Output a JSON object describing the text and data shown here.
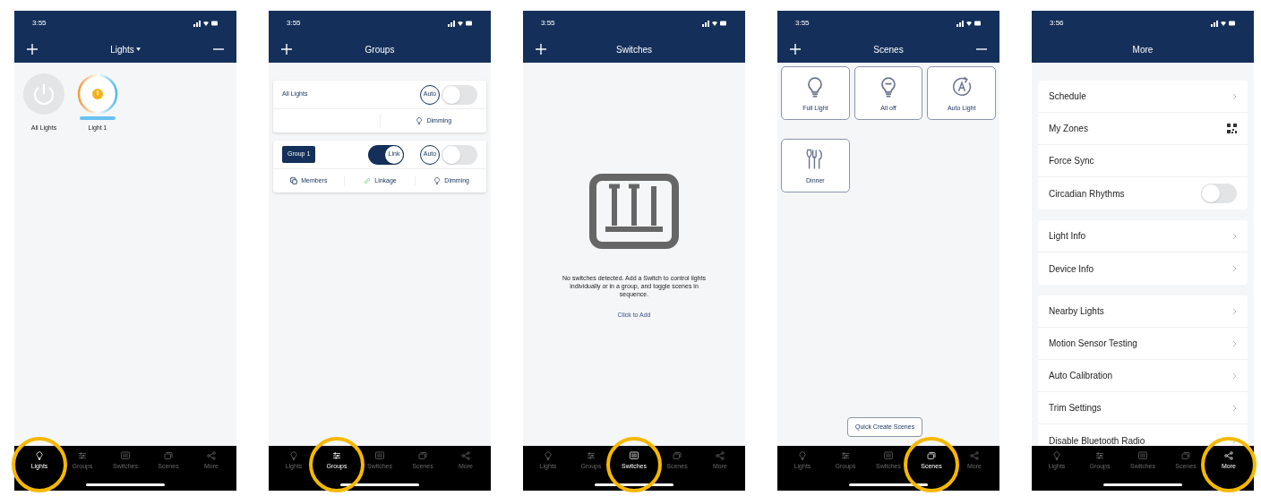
{
  "phones": [
    {
      "kind": "lights",
      "status_time": "3:55",
      "title": "Lights",
      "lights": [
        {
          "label": "All Lights",
          "on": false
        },
        {
          "label": "Light 1",
          "on": true
        }
      ],
      "tabs": [
        {
          "label": "Lights",
          "selected": true
        },
        {
          "label": "Groups",
          "selected": false
        },
        {
          "label": "Switches",
          "selected": false
        },
        {
          "label": "Scenes",
          "selected": false
        },
        {
          "label": "More",
          "selected": false
        }
      ]
    },
    {
      "kind": "groups",
      "status_time": "3:55",
      "title": "Groups",
      "groups": [
        {
          "kind": "all",
          "name": "All Lights",
          "auto_label": "Auto",
          "auto_on": false,
          "actions": [
            {
              "kind": "dimming",
              "label": "Dimming"
            }
          ]
        },
        {
          "kind": "group",
          "name": "Group 1",
          "link_label": "Link",
          "link_on": true,
          "auto_label": "Auto",
          "auto_on": false,
          "actions": [
            {
              "kind": "members",
              "label": "Members"
            },
            {
              "kind": "linkage",
              "label": "Linkage"
            },
            {
              "kind": "dimming",
              "label": "Dimming"
            }
          ]
        }
      ],
      "tabs": [
        {
          "label": "Lights",
          "selected": false
        },
        {
          "label": "Groups",
          "selected": true
        },
        {
          "label": "Switches",
          "selected": false
        },
        {
          "label": "Scenes",
          "selected": false
        },
        {
          "label": "More",
          "selected": false
        }
      ]
    },
    {
      "kind": "switches",
      "status_time": "3:55",
      "title": "Switches",
      "message": "No switches detected. Add a Switch to control lights individually or in a group, and toggle scenes in sequence.",
      "link": "Click to Add",
      "tabs": [
        {
          "label": "Lights",
          "selected": false
        },
        {
          "label": "Groups",
          "selected": false
        },
        {
          "label": "Switches",
          "selected": true
        },
        {
          "label": "Scenes",
          "selected": false
        },
        {
          "label": "More",
          "selected": false
        }
      ]
    },
    {
      "kind": "scenes",
      "status_time": "3:55",
      "title": "Scenes",
      "scenes": [
        {
          "kind": "full",
          "label": "Full Light"
        },
        {
          "kind": "off",
          "label": "All off"
        },
        {
          "kind": "auto",
          "label": "Auto Light"
        },
        {
          "kind": "dinner",
          "label": "Dinner"
        }
      ],
      "quick_button": "Quick Create Scenes",
      "tabs": [
        {
          "label": "Lights",
          "selected": false
        },
        {
          "label": "Groups",
          "selected": false
        },
        {
          "label": "Switches",
          "selected": false
        },
        {
          "label": "Scenes",
          "selected": true
        },
        {
          "label": "More",
          "selected": false
        }
      ]
    },
    {
      "kind": "more",
      "status_time": "3:56",
      "title": "More",
      "sections": [
        [
          {
            "label": "Schedule",
            "kind": "chevron"
          },
          {
            "label": "My Zones",
            "kind": "qr"
          },
          {
            "label": "Force Sync",
            "kind": "plain"
          },
          {
            "label": "Circadian Rhythms",
            "kind": "toggle",
            "on": false
          }
        ],
        [
          {
            "label": "Light Info",
            "kind": "chevron"
          },
          {
            "label": "Device Info",
            "kind": "chevron"
          }
        ],
        [
          {
            "label": "Nearby Lights",
            "kind": "chevron"
          },
          {
            "label": "Motion Sensor Testing",
            "kind": "chevron"
          },
          {
            "label": "Auto Calibration",
            "kind": "chevron"
          },
          {
            "label": "Trim Settings",
            "kind": "chevron"
          },
          {
            "label": "Disable Bluetooth Radio",
            "kind": "chevron"
          }
        ]
      ],
      "tabs": [
        {
          "label": "Lights",
          "selected": false
        },
        {
          "label": "Groups",
          "selected": false
        },
        {
          "label": "Switches",
          "selected": false
        },
        {
          "label": "Scenes",
          "selected": false
        },
        {
          "label": "More",
          "selected": true
        }
      ]
    }
  ]
}
